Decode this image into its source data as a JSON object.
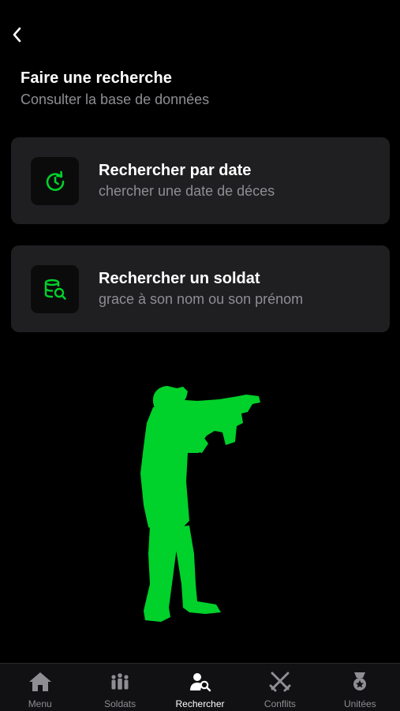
{
  "header": {
    "title": "Faire une recherche",
    "subtitle": "Consulter la base de données"
  },
  "cards": [
    {
      "title": "Rechercher par date",
      "subtitle": "chercher une date de déces",
      "icon": "clock-refresh-icon"
    },
    {
      "title": "Rechercher un soldat",
      "subtitle": "grace à son nom ou son prénom",
      "icon": "database-search-icon"
    }
  ],
  "tabs": [
    {
      "label": "Menu",
      "icon": "home-icon"
    },
    {
      "label": "Soldats",
      "icon": "soldiers-icon"
    },
    {
      "label": "Rechercher",
      "icon": "user-search-icon",
      "active": true
    },
    {
      "label": "Conflits",
      "icon": "crossed-swords-icon"
    },
    {
      "label": "Unitées",
      "icon": "medal-icon"
    }
  ],
  "colors": {
    "accent": "#00d12b",
    "card_bg": "#1f1f21",
    "secondary_text": "#8e8e93",
    "tab_inactive": "#8e8e93"
  }
}
